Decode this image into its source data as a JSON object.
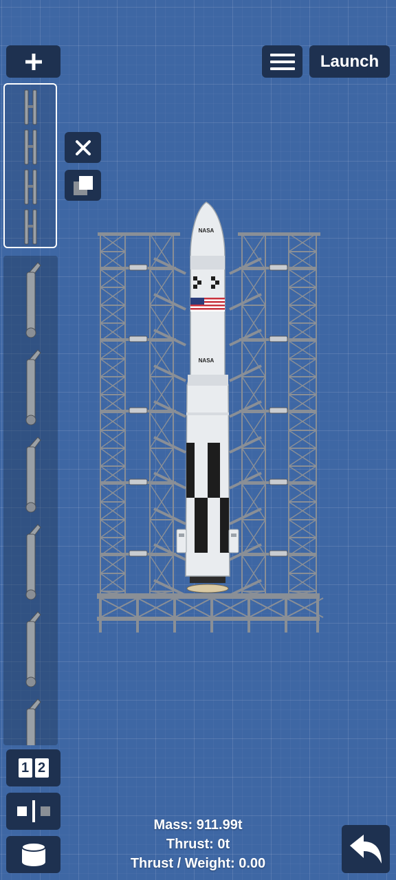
{
  "toolbar": {
    "launch_label": "Launch",
    "add_icon": "plus-icon",
    "menu_icon": "hamburger-menu-icon"
  },
  "edit_tools": {
    "delete_icon": "close-icon",
    "clone_icon": "clone-icon"
  },
  "bottom_tools": {
    "stage_icon": "stage-numbers-icon",
    "stage_numbers": [
      "1",
      "2"
    ],
    "symmetry_icon": "symmetry-icon",
    "fuel_icon": "fuel-tank-icon",
    "undo_icon": "undo-icon"
  },
  "parts_panel": {
    "selected_part_icon": "launch-tower-segment-icon",
    "items": [
      {
        "icon": "tower-arm-part-icon"
      },
      {
        "icon": "tower-arm-part-icon"
      },
      {
        "icon": "tower-arm-part-icon"
      },
      {
        "icon": "tower-arm-part-icon"
      },
      {
        "icon": "tower-arm-part-icon"
      },
      {
        "icon": "tower-arm-part-icon"
      }
    ]
  },
  "rocket": {
    "decal_top": "NASA",
    "decal_middle": "NASA",
    "colors": {
      "body": "#e9ecef",
      "checker": "#1d1d1d",
      "flag_red": "#c8313c",
      "flag_blue": "#2a3d7a"
    }
  },
  "stats": {
    "mass": "Mass: 911.99t",
    "thrust": "Thrust: 0t",
    "twr": "Thrust / Weight: 0.00"
  },
  "colors": {
    "background": "#3e67a4",
    "button_bg": "#1e3150",
    "tower": "#8a8f96"
  }
}
